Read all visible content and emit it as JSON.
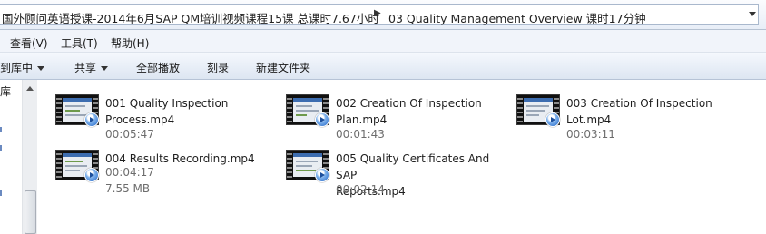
{
  "address": {
    "crumbs": [
      "国外顾问英语授课-2014年6月SAP QM培训视频课程15课  总课时7.67小时",
      "03 Quality Management Overview 课时17分钟"
    ]
  },
  "menu": {
    "view": "查看(V)",
    "tools": "工具(T)",
    "help": "帮助(H)"
  },
  "toolbar": {
    "include_library": "到库中",
    "share": "共享",
    "play_all": "全部播放",
    "burn": "刻录",
    "new_folder": "新建文件夹"
  },
  "nav": {
    "partial_label": "库"
  },
  "files": [
    {
      "name_line1": "001 Quality Inspection",
      "name_line2": "Process.mp4",
      "duration": "00:05:47",
      "size": ""
    },
    {
      "name_line1": "002 Creation Of Inspection",
      "name_line2": "Plan.mp4",
      "duration": "00:01:43",
      "size": ""
    },
    {
      "name_line1": "003 Creation Of Inspection",
      "name_line2": "Lot.mp4",
      "duration": "00:03:11",
      "size": ""
    },
    {
      "name_line1": "004 Results Recording.mp4",
      "name_line2": "",
      "duration": "00:04:17",
      "size": "7.55 MB"
    },
    {
      "name_line1": "005 Quality Certificates And SAP",
      "name_line2": "Reports.mp4",
      "duration": "00:02:14",
      "size": ""
    }
  ]
}
